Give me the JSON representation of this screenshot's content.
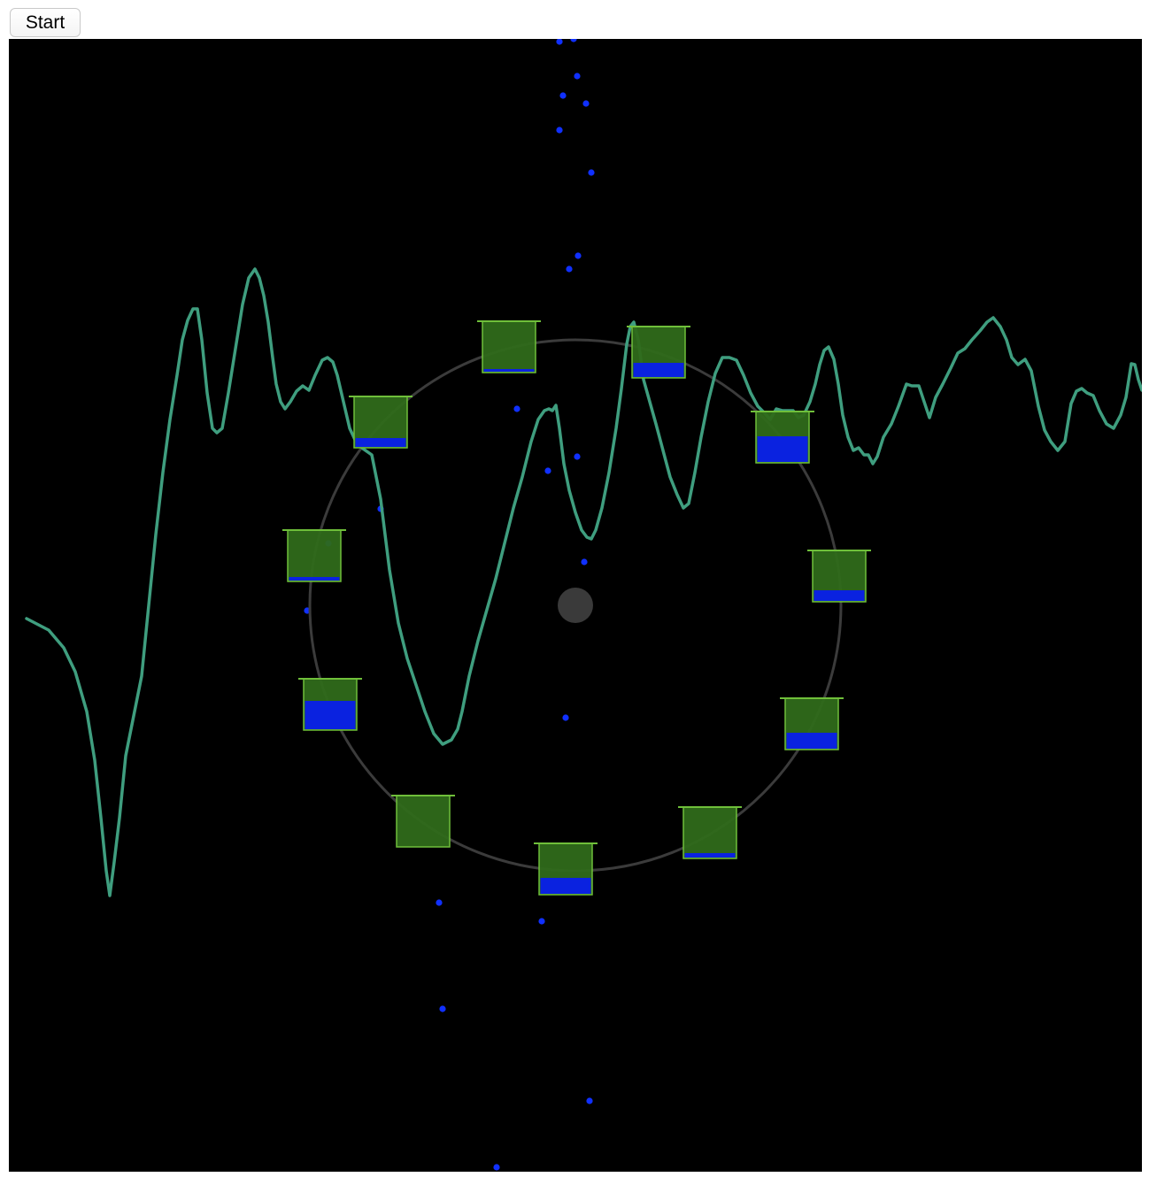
{
  "toolbar": {
    "start_label": "Start"
  },
  "simulation": {
    "colors": {
      "background": "#000000",
      "waveform": "#3f9e7f",
      "orbit": "#3b3b3b",
      "hub": "#3a3a3a",
      "bucket_fill": "#2f6a1a",
      "bucket_border": "#6fbf3a",
      "water": "#0a22e0",
      "drop": "#1030ff"
    },
    "bucket_fill_levels": [
      0.06,
      0.28,
      0.52,
      0.17,
      0.22,
      0.08,
      0.32,
      0.0,
      0.33,
      0.58,
      0.09
    ]
  }
}
